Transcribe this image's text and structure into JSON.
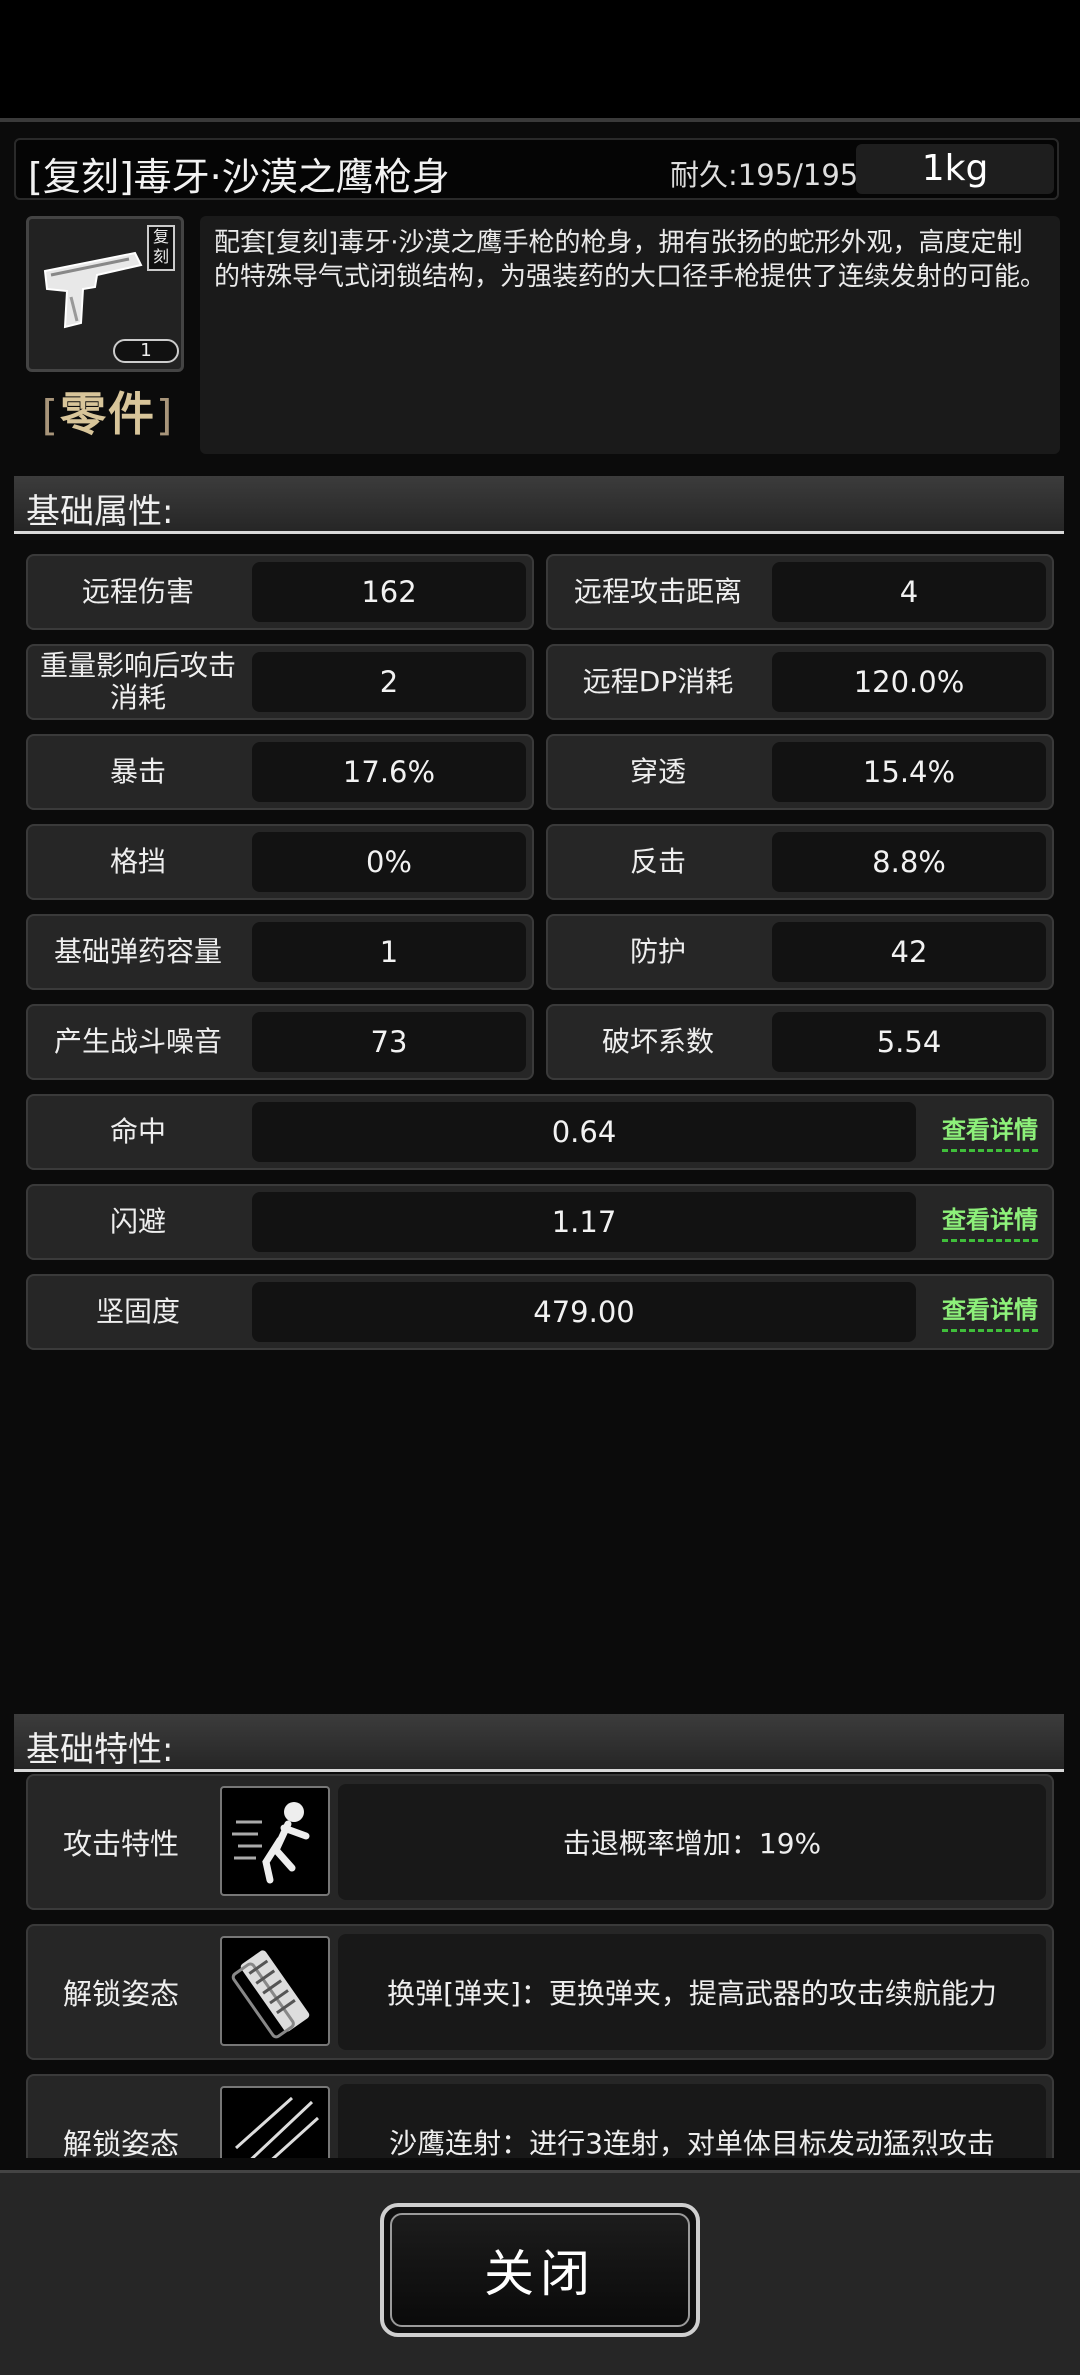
{
  "item": {
    "name": "[复刻]毒牙·沙漠之鹰枪身",
    "durability": "耐久:195/195",
    "weight": "1kg",
    "tag": "复刻",
    "count": "1",
    "category": "零件",
    "category_open": "[",
    "category_close": "]",
    "description": "配套[复刻]毒牙·沙漠之鹰手枪的枪身，拥有张扬的蛇形外观，高度定制的特殊导气式闭锁结构，为强装药的大口径手枪提供了连续发射的可能。",
    "icon": "pistol-frame-icon"
  },
  "sections": {
    "basic_attributes": "基础属性:",
    "basic_traits": "基础特性:"
  },
  "attributes": [
    {
      "label": "远程伤害",
      "value": "162"
    },
    {
      "label": "远程攻击距离",
      "value": "4"
    },
    {
      "label": "重量影响后攻击消耗",
      "value": "2"
    },
    {
      "label": "远程DP消耗",
      "value": "120.0%"
    },
    {
      "label": "暴击",
      "value": "17.6%"
    },
    {
      "label": "穿透",
      "value": "15.4%"
    },
    {
      "label": "格挡",
      "value": "0%"
    },
    {
      "label": "反击",
      "value": "8.8%"
    },
    {
      "label": "基础弹药容量",
      "value": "1"
    },
    {
      "label": "防护",
      "value": "42"
    },
    {
      "label": "产生战斗噪音",
      "value": "73"
    },
    {
      "label": "破坏系数",
      "value": "5.54"
    }
  ],
  "wide_attributes": [
    {
      "label": "命中",
      "value": "0.64",
      "link": "查看详情"
    },
    {
      "label": "闪避",
      "value": "1.17",
      "link": "查看详情"
    },
    {
      "label": "坚固度",
      "value": "479.00",
      "link": "查看详情"
    }
  ],
  "traits": [
    {
      "label": "攻击特性",
      "text": "击退概率增加：19%",
      "icon": "knockback-icon"
    },
    {
      "label": "解锁姿态",
      "text": "换弹[弹夹]：更换弹夹，提高武器的攻击续航能力",
      "icon": "magazine-reload-icon"
    },
    {
      "label": "解锁姿态",
      "text": "沙鹰连射：进行3连射，对单体目标发动猛烈攻击",
      "icon": "rapid-fire-icon"
    }
  ],
  "footer": {
    "close_label": "关闭"
  },
  "colors": {
    "link": "#8df07a",
    "category": "#d8c59a",
    "background": "#000000"
  }
}
